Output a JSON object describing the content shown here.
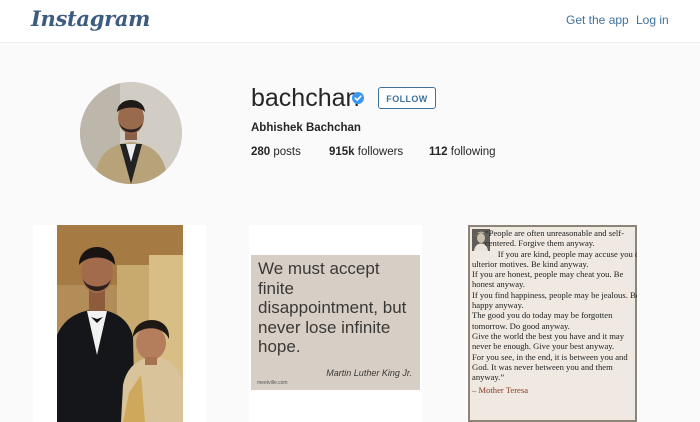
{
  "header": {
    "logo": "Instagram",
    "get_app": "Get the app",
    "login": "Log in"
  },
  "profile": {
    "username": "bachchan",
    "follow_label": "FOLLOW",
    "full_name": "Abhishek Bachchan",
    "posts_count": "280",
    "posts_label": "posts",
    "followers_count": "915k",
    "followers_label": "followers",
    "following_count": "112",
    "following_label": "following"
  },
  "posts": {
    "quote2": {
      "text": "We must accept finite disappointment, but never lose infinite hope.",
      "author": "Martin Luther King Jr.",
      "site": "meetville.com"
    },
    "quote3": {
      "text": "      “People are often unreasonable and self-\n      centered. Forgive them anyway.\n            If you are kind, people may accuse you of\nulterior motives. Be kind anyway.\nIf you are honest, people may cheat you. Be\nhonest anyway.\nIf you find happiness, people may be jealous. Be\nhappy anyway.\nThe good you do today may be forgotten\ntomorrow. Do good anyway.\nGive the world the best you have and it may\nnever be enough. Give your best anyway.\nFor you see, in the end, it is between you and\nGod. It was never between you and them\nanyway.”",
      "author": "– Mother Teresa"
    }
  },
  "colors": {
    "link": "#3f729b",
    "verified": "#3897f0",
    "background": "#fafafa"
  },
  "icons": {
    "verified": "verified-badge-icon"
  }
}
